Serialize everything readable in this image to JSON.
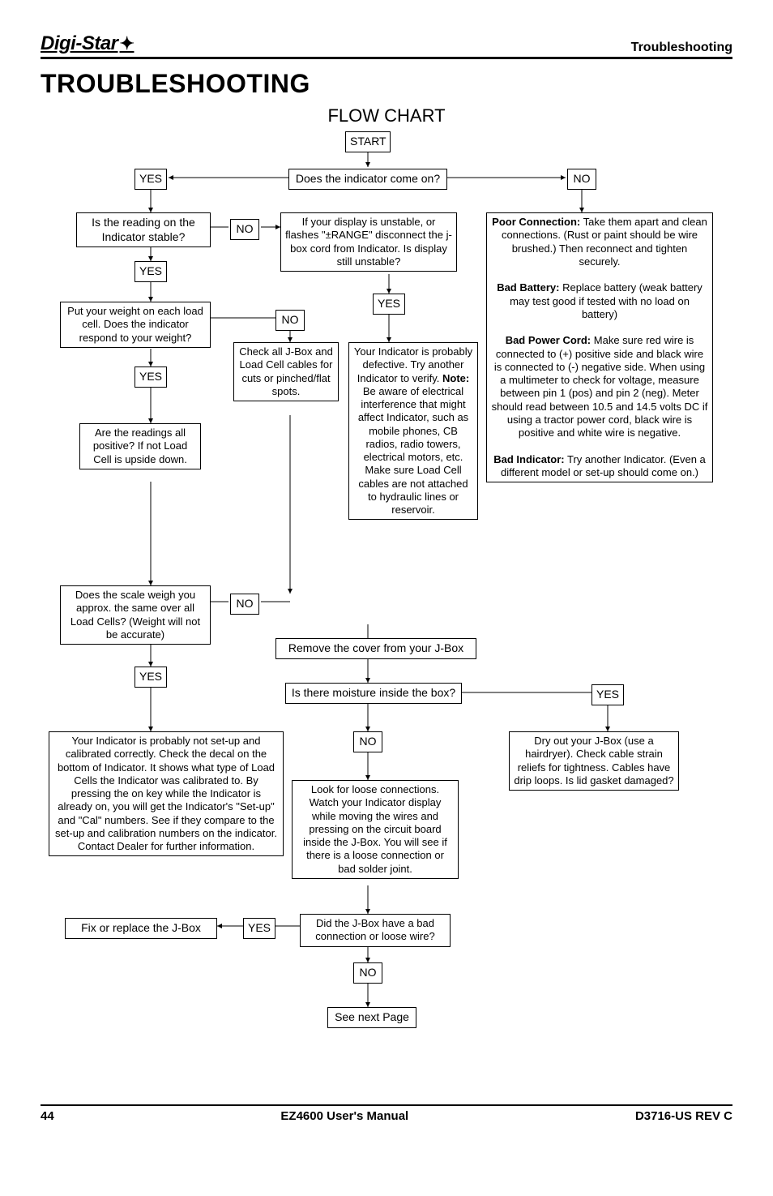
{
  "header": {
    "logo_text": "Digi-Star",
    "section": "Troubleshooting"
  },
  "title": "TROUBLESHOOTING",
  "subtitle": "FLOW CHART",
  "nodes": {
    "start": "START",
    "q_indicator_on": "Does the indicator come on?",
    "yes1": "YES",
    "no1": "NO",
    "q_reading_stable": "Is the reading on the Indicator stable?",
    "no2": "NO",
    "unstable_display": "If your display is unstable, or flashes \"±RANGE\" disconnect the j-box cord from Indicator. Is display still unstable?",
    "yes2": "YES",
    "poor_conn_header": "Poor Connection:",
    "poor_conn_body": " Take them apart and clean connections. (Rust or paint should be wire brushed.) Then reconnect and tighten securely.",
    "bad_batt_header": "Bad Battery:",
    "bad_batt_body": " Replace battery (weak battery may test good if tested with no load on battery)",
    "bad_cord_header": "Bad Power Cord:",
    "bad_cord_body": " Make sure red wire is connected to (+) positive side and black wire is connected to (-) negative side. When using a multimeter to check for voltage, measure between pin 1 (pos) and pin 2 (neg). Meter should read between 10.5 and 14.5 volts DC if using a tractor power cord, black wire is positive and white wire is negative.",
    "bad_ind_header": "Bad Indicator:",
    "bad_ind_body": " Try another Indicator. (Even a different model or set-up should come on.)",
    "q_put_weight": "Put your weight on each load cell. Does the indicator respond to your weight?",
    "no3": "NO",
    "yes3": "YES",
    "yes4": "YES",
    "check_jbox_cables": "Check all J-Box and Load Cell cables for cuts or pinched/flat spots.",
    "defective_ind": "Your Indicator is probably defective. Try another Indicator to verify. ",
    "defective_note": "Note:",
    "defective_rest": " Be aware of electrical interference that might affect Indicator, such as mobile phones, CB radios, radio towers, electrical motors, etc. Make sure Load Cell cables are not attached to hydraulic lines or reservoir.",
    "q_all_positive": "Are the readings all positive? If not Load Cell is upside down.",
    "q_same_weight": "Does the scale weigh you approx. the same over all Load Cells? (Weight will not be accurate)",
    "no4": "NO",
    "yes5": "YES",
    "remove_cover": "Remove the cover from your J-Box",
    "q_moisture": "Is there moisture inside the box?",
    "yes6": "YES",
    "dry_jbox": "Dry out your J-Box (use a hairdryer). Check cable strain reliefs for tightness. Cables have drip loops. Is lid gasket damaged?",
    "no5": "NO",
    "calibrate_text": "Your Indicator is probably not set-up and calibrated correctly. Check the decal on the bottom of Indicator. It shows what type of Load Cells the Indicator was calibrated to. By pressing the on key while the Indicator is already on, you will get the Indicator's \"Set-up\" and \"Cal\" numbers. See if they compare to the set-up and calibration numbers on the indicator. Contact Dealer for further information.",
    "loose_conn": "Look for loose connections. Watch your Indicator display while moving the wires and pressing on the circuit board inside the J-Box. You will see if there is a loose connection or bad solder joint.",
    "q_bad_conn": "Did the J-Box have a bad connection or loose wire?",
    "yes7": "YES",
    "fix_jbox": "Fix or replace the J-Box",
    "no6": "NO",
    "next_page": "See next Page"
  },
  "footer": {
    "page": "44",
    "center": "EZ4600 User's Manual",
    "right": "D3716-US  REV C"
  }
}
